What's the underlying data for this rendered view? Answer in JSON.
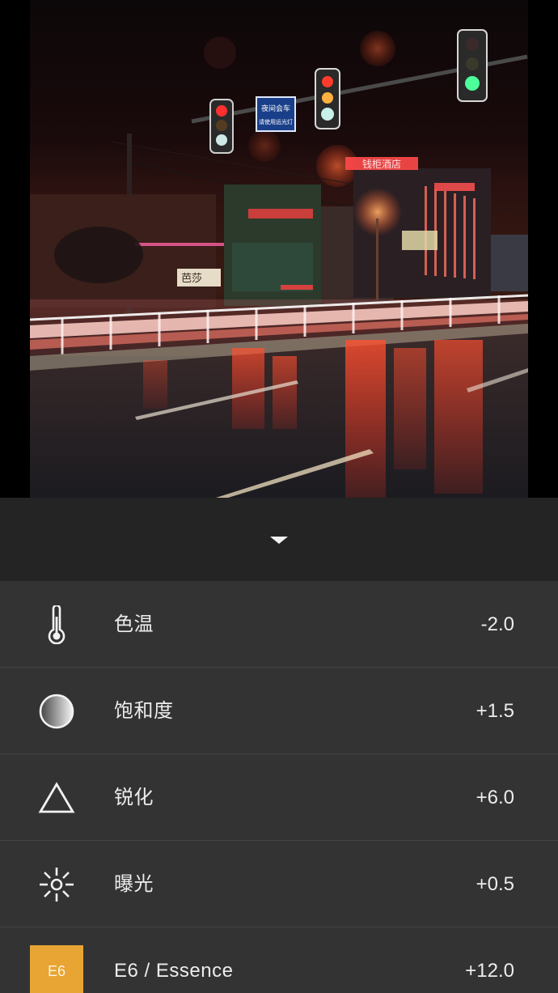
{
  "photo": {
    "sign_text": [
      "夜间会车",
      "请使用远光灯"
    ],
    "shop_signs": [
      "芭莎",
      "钱柜酒店"
    ]
  },
  "panel": {
    "collapse_icon": "chevron-down-icon",
    "rows": [
      {
        "icon": "thermometer-icon",
        "label": "色温",
        "value": "-2.0"
      },
      {
        "icon": "saturation-icon",
        "label": "饱和度",
        "value": "+1.5"
      },
      {
        "icon": "sharpen-triangle-icon",
        "label": "锐化",
        "value": "+6.0"
      },
      {
        "icon": "exposure-sun-icon",
        "label": "曝光",
        "value": "+0.5"
      },
      {
        "icon": "preset-badge",
        "badge": "E6",
        "label": "E6 / Essence",
        "value": "+12.0"
      }
    ]
  },
  "colors": {
    "panel_bg": "#242424",
    "row_bg": "#333333",
    "badge": "#e8a534"
  }
}
